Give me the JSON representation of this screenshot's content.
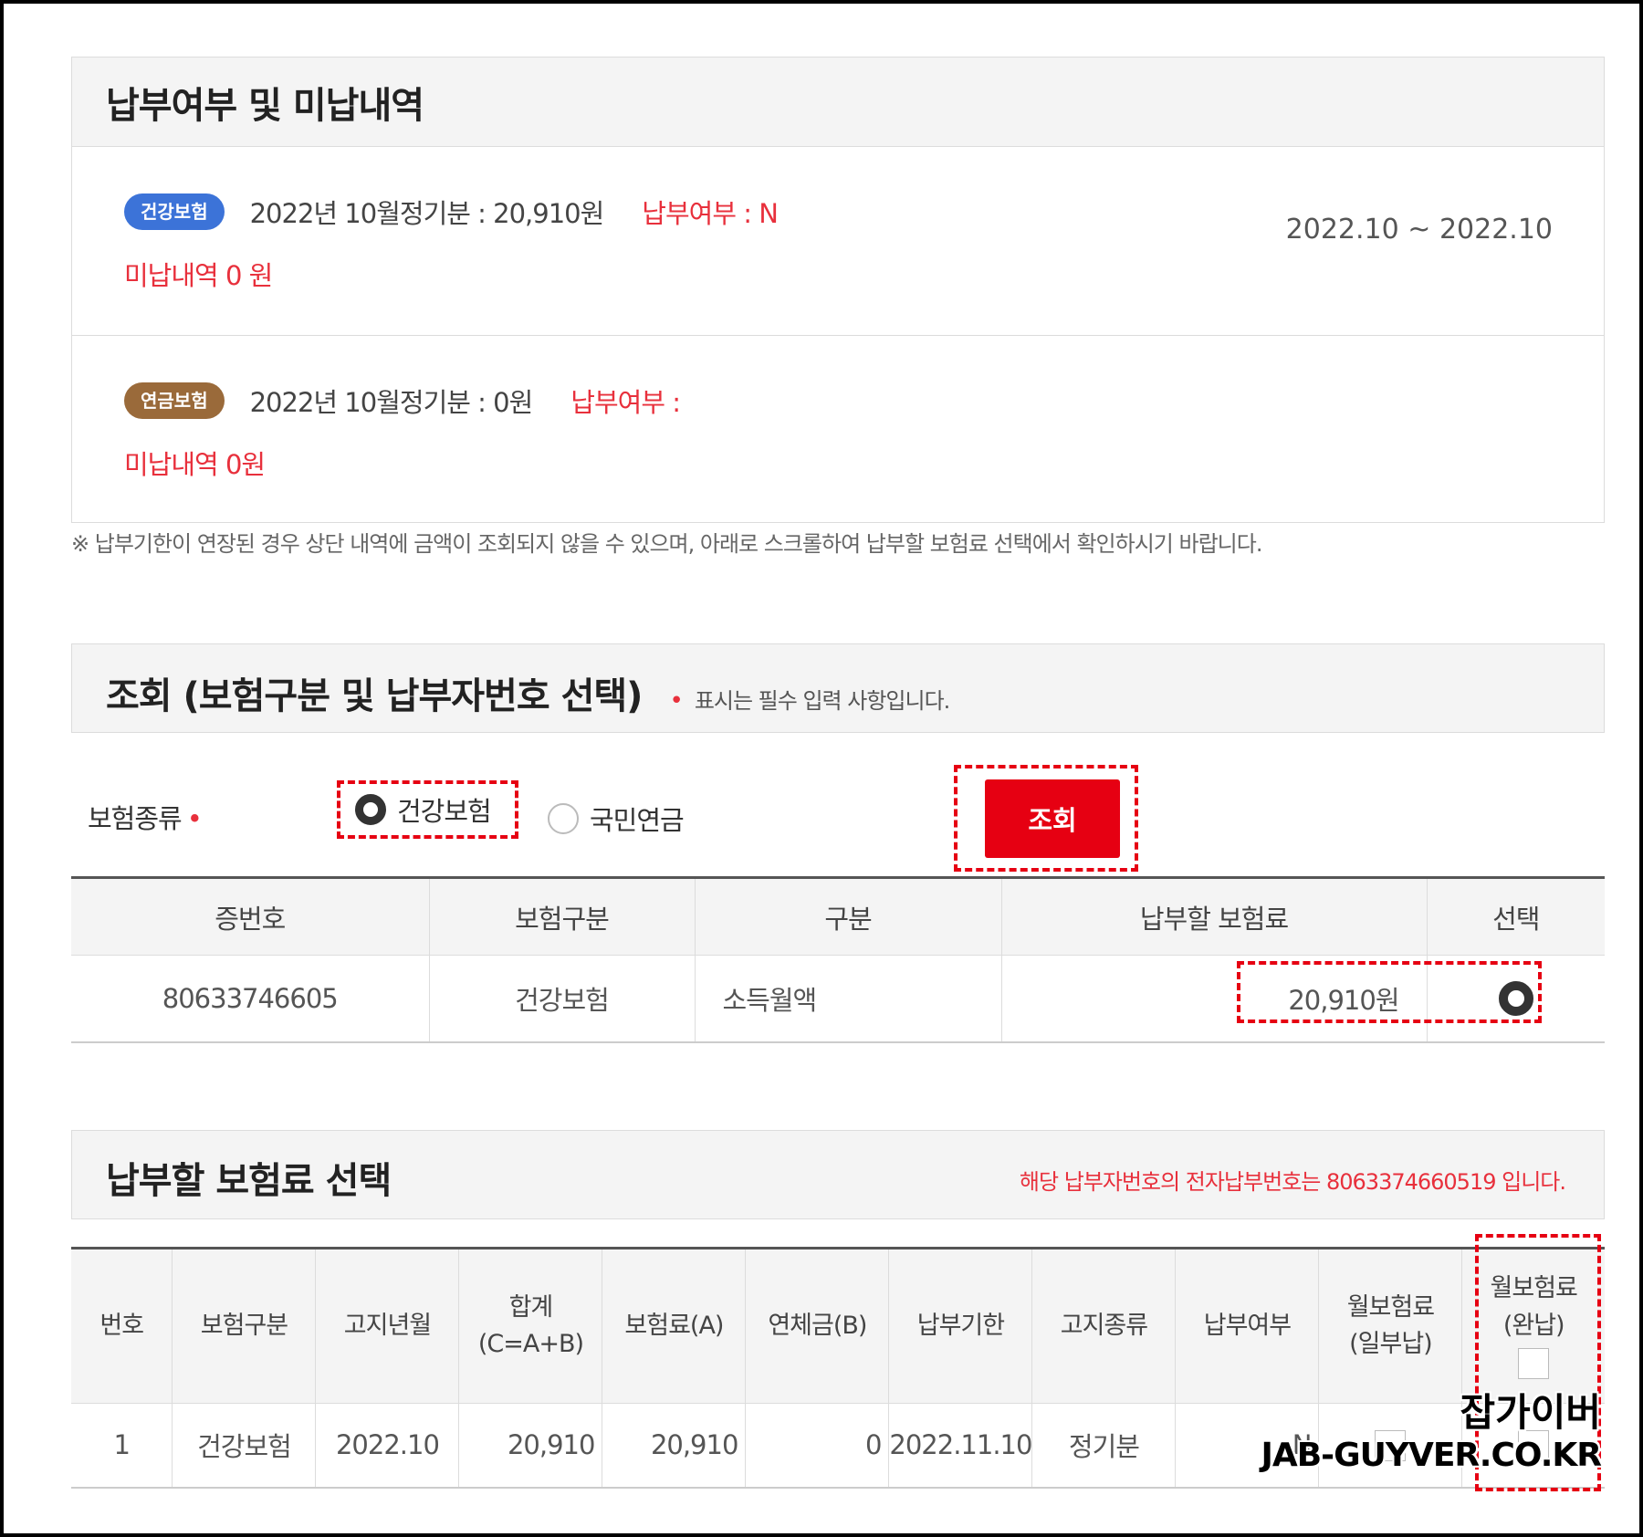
{
  "payment_status": {
    "title": "납부여부 및 미납내역",
    "health": {
      "badge": "건강보험",
      "period": "2022년 10월정기분 : 20,910원",
      "paid": "납부여부 : N",
      "unpaid": "미납내역  0 원",
      "date_range": "2022.10 ~ 2022.10"
    },
    "pension": {
      "badge": "연금보험",
      "period": "2022년 10월정기분 : 0원",
      "paid": "납부여부 :",
      "unpaid": "미납내역  0원"
    },
    "notice": "※ 납부기한이 연장된 경우 상단 내역에 금액이 조회되지 않을 수 있으며, 아래로 스크롤하여 납부할 보험료 선택에서 확인하시기 바랍니다."
  },
  "search": {
    "title": "조회 (보험구분 및 납부자번호 선택)",
    "required_dot": "•",
    "required_note": "표시는 필수 입력 사항입니다.",
    "type_label": "보험종류",
    "type_dot": "•",
    "option_health": "건강보험",
    "option_pension": "국민연금",
    "search_button": "조회",
    "table": {
      "headers": [
        "증번호",
        "보험구분",
        "구분",
        "납부할 보험료",
        "선택"
      ],
      "row": {
        "id": "80633746605",
        "insurance": "건강보험",
        "category": "소득월액",
        "amount": "20,910원"
      }
    }
  },
  "select": {
    "title": "납부할 보험료 선택",
    "epay_note": "해당 납부자번호의 전자납부번호는 8063374660519 입니다.",
    "headers": [
      "번호",
      "보험구분",
      "고지년월",
      "합계",
      "(C=A+B)",
      "보험료(A)",
      "연체금(B)",
      "납부기한",
      "고지종류",
      "납부여부",
      "월보험료",
      "(일부납)",
      "월보험료",
      "(완납)"
    ],
    "row": {
      "no": "1",
      "insurance": "건강보험",
      "month": "2022.10",
      "total": "20,910",
      "premium": "20,910",
      "late_fee": "0",
      "due": "2022.11.10",
      "kind": "정기분",
      "paid": "N"
    }
  },
  "watermark": {
    "line1": "잡가이버",
    "line2": "JAB-GUYVER.CO.KR"
  }
}
